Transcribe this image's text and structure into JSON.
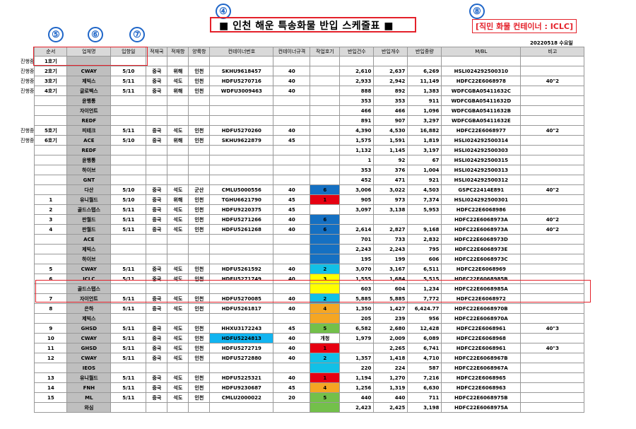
{
  "title": "■  인천 해운 특송화물 반입 스케줄표  ■",
  "note": "[직민 화물 컨테이너 : ICLC]",
  "date": "20220518 수요일",
  "callouts": [
    "④",
    "⑤",
    "⑥",
    "⑦",
    "⑧"
  ],
  "colors": {
    "highlight": "#e4212a",
    "callout": "#1f66c8"
  },
  "headers": [
    "순서",
    "업체명",
    "입항일",
    "적재국",
    "적재항",
    "양륙항",
    "컨테이너번호",
    "컨테이너규격",
    "작업호기",
    "반입건수",
    "반입개수",
    "반입중량",
    "M/BL",
    "비고"
  ],
  "rows": [
    {
      "status": "진행중",
      "no": "1호기",
      "vendor": "",
      "date": "",
      "country": "",
      "lport": "",
      "dport": "",
      "cntr": "",
      "size": "",
      "work": "",
      "cnt": "",
      "pcs": "",
      "wt": "",
      "mbl": "",
      "note": "",
      "workColor": ""
    },
    {
      "status": "진행중",
      "no": "2호기",
      "vendor": "CWAY",
      "date": "5/10",
      "country": "중국",
      "lport": "위해",
      "dport": "인천",
      "cntr": "SKHU9618457",
      "size": "40",
      "work": "",
      "cnt": "2,610",
      "pcs": "2,637",
      "wt": "6,269",
      "mbl": "HSLI024292500310",
      "note": "",
      "workColor": ""
    },
    {
      "status": "진행중",
      "no": "3호기",
      "vendor": "제빅스",
      "date": "5/11",
      "country": "중국",
      "lport": "석도",
      "dport": "인천",
      "cntr": "HDFU5270716",
      "size": "40",
      "work": "",
      "cnt": "2,933",
      "pcs": "2,942",
      "wt": "11,149",
      "mbl": "HDFC22E6068978",
      "note": "40\"2",
      "workColor": ""
    },
    {
      "status": "진행중",
      "no": "4호기",
      "vendor": "글로벡스",
      "date": "5/11",
      "country": "중국",
      "lport": "위해",
      "dport": "인천",
      "cntr": "WDFU3009463",
      "size": "40",
      "work": "",
      "cnt": "888",
      "pcs": "892",
      "wt": "1,383",
      "mbl": "WDFCGBA05411632C",
      "note": "",
      "workColor": ""
    },
    {
      "status": "",
      "no": "",
      "vendor": "윤행통",
      "date": "",
      "country": "",
      "lport": "",
      "dport": "",
      "cntr": "",
      "size": "",
      "work": "",
      "cnt": "353",
      "pcs": "353",
      "wt": "911",
      "mbl": "WDFCGBA05411632D",
      "note": "",
      "workColor": ""
    },
    {
      "status": "",
      "no": "",
      "vendor": "자이언트",
      "date": "",
      "country": "",
      "lport": "",
      "dport": "",
      "cntr": "",
      "size": "",
      "work": "",
      "cnt": "466",
      "pcs": "466",
      "wt": "1,096",
      "mbl": "WDFCGBA05411632B",
      "note": "",
      "workColor": ""
    },
    {
      "status": "",
      "no": "",
      "vendor": "REDF",
      "date": "",
      "country": "",
      "lport": "",
      "dport": "",
      "cntr": "",
      "size": "",
      "work": "",
      "cnt": "891",
      "pcs": "907",
      "wt": "3,297",
      "mbl": "WDFCGBA05411632E",
      "note": "",
      "workColor": ""
    },
    {
      "status": "진행중",
      "no": "5호기",
      "vendor": "피테크",
      "date": "5/11",
      "country": "중국",
      "lport": "석도",
      "dport": "인천",
      "cntr": "HDFU5270260",
      "size": "40",
      "work": "",
      "cnt": "4,390",
      "pcs": "4,530",
      "wt": "16,882",
      "mbl": "HDFC22E6068977",
      "note": "40\"2",
      "workColor": ""
    },
    {
      "status": "진행중",
      "no": "6호기",
      "vendor": "ACE",
      "date": "5/10",
      "country": "중국",
      "lport": "위해",
      "dport": "인천",
      "cntr": "SKHU9622879",
      "size": "45",
      "work": "",
      "cnt": "1,575",
      "pcs": "1,591",
      "wt": "1,819",
      "mbl": "HSLI024292500314",
      "note": "",
      "workColor": ""
    },
    {
      "status": "",
      "no": "",
      "vendor": "REDF",
      "date": "",
      "country": "",
      "lport": "",
      "dport": "",
      "cntr": "",
      "size": "",
      "work": "",
      "cnt": "1,132",
      "pcs": "1,145",
      "wt": "3,197",
      "mbl": "HSLI024292500303",
      "note": "",
      "workColor": ""
    },
    {
      "status": "",
      "no": "",
      "vendor": "윤행통",
      "date": "",
      "country": "",
      "lport": "",
      "dport": "",
      "cntr": "",
      "size": "",
      "work": "",
      "cnt": "1",
      "pcs": "92",
      "wt": "67",
      "mbl": "HSLI024292500315",
      "note": "",
      "workColor": ""
    },
    {
      "status": "",
      "no": "",
      "vendor": "하이브",
      "date": "",
      "country": "",
      "lport": "",
      "dport": "",
      "cntr": "",
      "size": "",
      "work": "",
      "cnt": "353",
      "pcs": "376",
      "wt": "1,004",
      "mbl": "HSLI024292500313",
      "note": "",
      "workColor": ""
    },
    {
      "status": "",
      "no": "",
      "vendor": "GNT",
      "date": "",
      "country": "",
      "lport": "",
      "dport": "",
      "cntr": "",
      "size": "",
      "work": "",
      "cnt": "452",
      "pcs": "471",
      "wt": "921",
      "mbl": "HSLI024292500312",
      "note": "",
      "workColor": ""
    },
    {
      "status": "",
      "no": "",
      "vendor": "다산",
      "date": "5/10",
      "country": "중국",
      "lport": "석도",
      "dport": "군산",
      "cntr": "CMLU5000556",
      "size": "40",
      "work": "6",
      "cnt": "3,006",
      "pcs": "3,022",
      "wt": "4,503",
      "mbl": "GSPC22414E891",
      "note": "40\"2",
      "workColor": "blue"
    },
    {
      "status": "",
      "no": "1",
      "vendor": "유니월드",
      "date": "5/10",
      "country": "중국",
      "lport": "위해",
      "dport": "인천",
      "cntr": "TGHU6621790",
      "size": "45",
      "work": "1",
      "cnt": "905",
      "pcs": "973",
      "wt": "7,374",
      "mbl": "HSLI024292500301",
      "note": "",
      "workColor": "red"
    },
    {
      "status": "",
      "no": "2",
      "vendor": "골드스탭스",
      "date": "5/11",
      "country": "중국",
      "lport": "석도",
      "dport": "인천",
      "cntr": "HDFU9220375",
      "size": "45",
      "work": "",
      "cnt": "3,097",
      "pcs": "3,138",
      "wt": "5,953",
      "mbl": "HDFC22E6068986",
      "note": "",
      "workColor": ""
    },
    {
      "status": "",
      "no": "3",
      "vendor": "판월드",
      "date": "5/11",
      "country": "중국",
      "lport": "석도",
      "dport": "인천",
      "cntr": "HDFU5271266",
      "size": "40",
      "work": "6",
      "cnt": "",
      "pcs": "",
      "wt": "",
      "mbl": "HDFC22E6068973A",
      "note": "40\"2",
      "workColor": "blue"
    },
    {
      "status": "",
      "no": "4",
      "vendor": "판월드",
      "date": "5/11",
      "country": "중국",
      "lport": "석도",
      "dport": "인천",
      "cntr": "HDFU5261268",
      "size": "40",
      "work": "6",
      "cnt": "2,614",
      "pcs": "2,827",
      "wt": "9,168",
      "mbl": "HDFC22E6068973A",
      "note": "40\"2",
      "workColor": "blue"
    },
    {
      "status": "",
      "no": "",
      "vendor": "ACE",
      "date": "",
      "country": "",
      "lport": "",
      "dport": "",
      "cntr": "",
      "size": "",
      "work": "",
      "cnt": "701",
      "pcs": "733",
      "wt": "2,832",
      "mbl": "HDFC22E6068973D",
      "note": "",
      "workColor": "blue"
    },
    {
      "status": "",
      "no": "",
      "vendor": "제빅스",
      "date": "",
      "country": "",
      "lport": "",
      "dport": "",
      "cntr": "",
      "size": "",
      "work": "",
      "cnt": "2,243",
      "pcs": "2,243",
      "wt": "795",
      "mbl": "HDFC22E6068973E",
      "note": "",
      "workColor": "blue"
    },
    {
      "status": "",
      "no": "",
      "vendor": "하이브",
      "date": "",
      "country": "",
      "lport": "",
      "dport": "",
      "cntr": "",
      "size": "",
      "work": "",
      "cnt": "195",
      "pcs": "199",
      "wt": "606",
      "mbl": "HDFC22E6068973C",
      "note": "",
      "workColor": "blue"
    },
    {
      "status": "",
      "no": "5",
      "vendor": "CWAY",
      "date": "5/11",
      "country": "중국",
      "lport": "석도",
      "dport": "인천",
      "cntr": "HDFU5261592",
      "size": "40",
      "work": "2",
      "cnt": "3,070",
      "pcs": "3,167",
      "wt": "6,511",
      "mbl": "HDFC22E6068969",
      "note": "",
      "workColor": "cyan"
    },
    {
      "status": "",
      "no": "6",
      "vendor": "ICLC",
      "date": "5/11",
      "country": "중국",
      "lport": "석도",
      "dport": "인천",
      "cntr": "HDFU5271749",
      "size": "40",
      "work": "3",
      "cnt": "1,555",
      "pcs": "1,684",
      "wt": "5,515",
      "mbl": "HDFC22E6068985B",
      "note": "",
      "workColor": "yellow"
    },
    {
      "status": "",
      "no": "",
      "vendor": "골드스탭스",
      "date": "",
      "country": "",
      "lport": "",
      "dport": "",
      "cntr": "",
      "size": "",
      "work": "",
      "cnt": "603",
      "pcs": "604",
      "wt": "1,234",
      "mbl": "HDFC22E6068985A",
      "note": "",
      "workColor": "yellow"
    },
    {
      "status": "",
      "no": "7",
      "vendor": "자이언트",
      "date": "5/11",
      "country": "중국",
      "lport": "석도",
      "dport": "인천",
      "cntr": "HDFU5270085",
      "size": "40",
      "work": "2",
      "cnt": "5,885",
      "pcs": "5,885",
      "wt": "7,772",
      "mbl": "HDFC22E6068972",
      "note": "",
      "workColor": "cyan"
    },
    {
      "status": "",
      "no": "8",
      "vendor": "은하",
      "date": "5/11",
      "country": "중국",
      "lport": "석도",
      "dport": "인천",
      "cntr": "HDFU5261817",
      "size": "40",
      "work": "4",
      "cnt": "1,350",
      "pcs": "1,427",
      "wt": "6,424.77",
      "mbl": "HDFC22E6068970B",
      "note": "",
      "workColor": "orange"
    },
    {
      "status": "",
      "no": "",
      "vendor": "제빅스",
      "date": "",
      "country": "",
      "lport": "",
      "dport": "",
      "cntr": "",
      "size": "",
      "work": "",
      "cnt": "205",
      "pcs": "239",
      "wt": "956",
      "mbl": "HDFC22E6068970A",
      "note": "",
      "workColor": "orange"
    },
    {
      "status": "",
      "no": "9",
      "vendor": "GHSD",
      "date": "5/11",
      "country": "중국",
      "lport": "석도",
      "dport": "인천",
      "cntr": "HHXU3172243",
      "size": "45",
      "work": "5",
      "cnt": "6,582",
      "pcs": "2,680",
      "wt": "12,428",
      "mbl": "HDFC22E6068961",
      "note": "40\"3",
      "workColor": "green"
    },
    {
      "status": "",
      "no": "10",
      "vendor": "CWAY",
      "date": "5/11",
      "country": "중국",
      "lport": "석도",
      "dport": "인천",
      "cntr": "HDFU5224813",
      "size": "40",
      "work": "개청",
      "cnt": "1,979",
      "pcs": "2,009",
      "wt": "6,089",
      "mbl": "HDFC22E6068968",
      "note": "",
      "workColor": "",
      "cntrColor": "sky"
    },
    {
      "status": "",
      "no": "11",
      "vendor": "GHSD",
      "date": "5/11",
      "country": "중국",
      "lport": "석도",
      "dport": "인천",
      "cntr": "HDFU5272719",
      "size": "40",
      "work": "1",
      "cnt": "",
      "pcs": "2,265",
      "wt": "6,741",
      "mbl": "HDFC22E6068961",
      "note": "40\"3",
      "workColor": "red"
    },
    {
      "status": "",
      "no": "12",
      "vendor": "CWAY",
      "date": "5/11",
      "country": "중국",
      "lport": "석도",
      "dport": "인천",
      "cntr": "HDFU5272880",
      "size": "40",
      "work": "2",
      "cnt": "1,357",
      "pcs": "1,418",
      "wt": "4,710",
      "mbl": "HDFC22E6068967B",
      "note": "",
      "workColor": "cyan"
    },
    {
      "status": "",
      "no": "",
      "vendor": "IEOS",
      "date": "",
      "country": "",
      "lport": "",
      "dport": "",
      "cntr": "",
      "size": "",
      "work": "",
      "cnt": "220",
      "pcs": "224",
      "wt": "587",
      "mbl": "HDFC22E6068967A",
      "note": "",
      "workColor": "cyan"
    },
    {
      "status": "",
      "no": "13",
      "vendor": "유니월드",
      "date": "5/11",
      "country": "중국",
      "lport": "석도",
      "dport": "인천",
      "cntr": "HDFU5225321",
      "size": "40",
      "work": "1",
      "cnt": "1,194",
      "pcs": "1,270",
      "wt": "7,216",
      "mbl": "HDFC22E6068965",
      "note": "",
      "workColor": "red"
    },
    {
      "status": "",
      "no": "14",
      "vendor": "FNH",
      "date": "5/11",
      "country": "중국",
      "lport": "석도",
      "dport": "인천",
      "cntr": "HDFU9230687",
      "size": "45",
      "work": "4",
      "cnt": "1,256",
      "pcs": "1,319",
      "wt": "6,630",
      "mbl": "HDFC22E6068963",
      "note": "",
      "workColor": "orange"
    },
    {
      "status": "",
      "no": "15",
      "vendor": "ML",
      "date": "5/11",
      "country": "중국",
      "lport": "석도",
      "dport": "인천",
      "cntr": "CMLU2000022",
      "size": "20",
      "work": "5",
      "cnt": "440",
      "pcs": "440",
      "wt": "711",
      "mbl": "HDFC22E6068975B",
      "note": "",
      "workColor": "green"
    },
    {
      "status": "",
      "no": "",
      "vendor": "와심",
      "date": "",
      "country": "",
      "lport": "",
      "dport": "",
      "cntr": "",
      "size": "",
      "work": "",
      "cnt": "2,423",
      "pcs": "2,425",
      "wt": "3,198",
      "mbl": "HDFC22E6068975A",
      "note": "",
      "workColor": "green"
    }
  ]
}
